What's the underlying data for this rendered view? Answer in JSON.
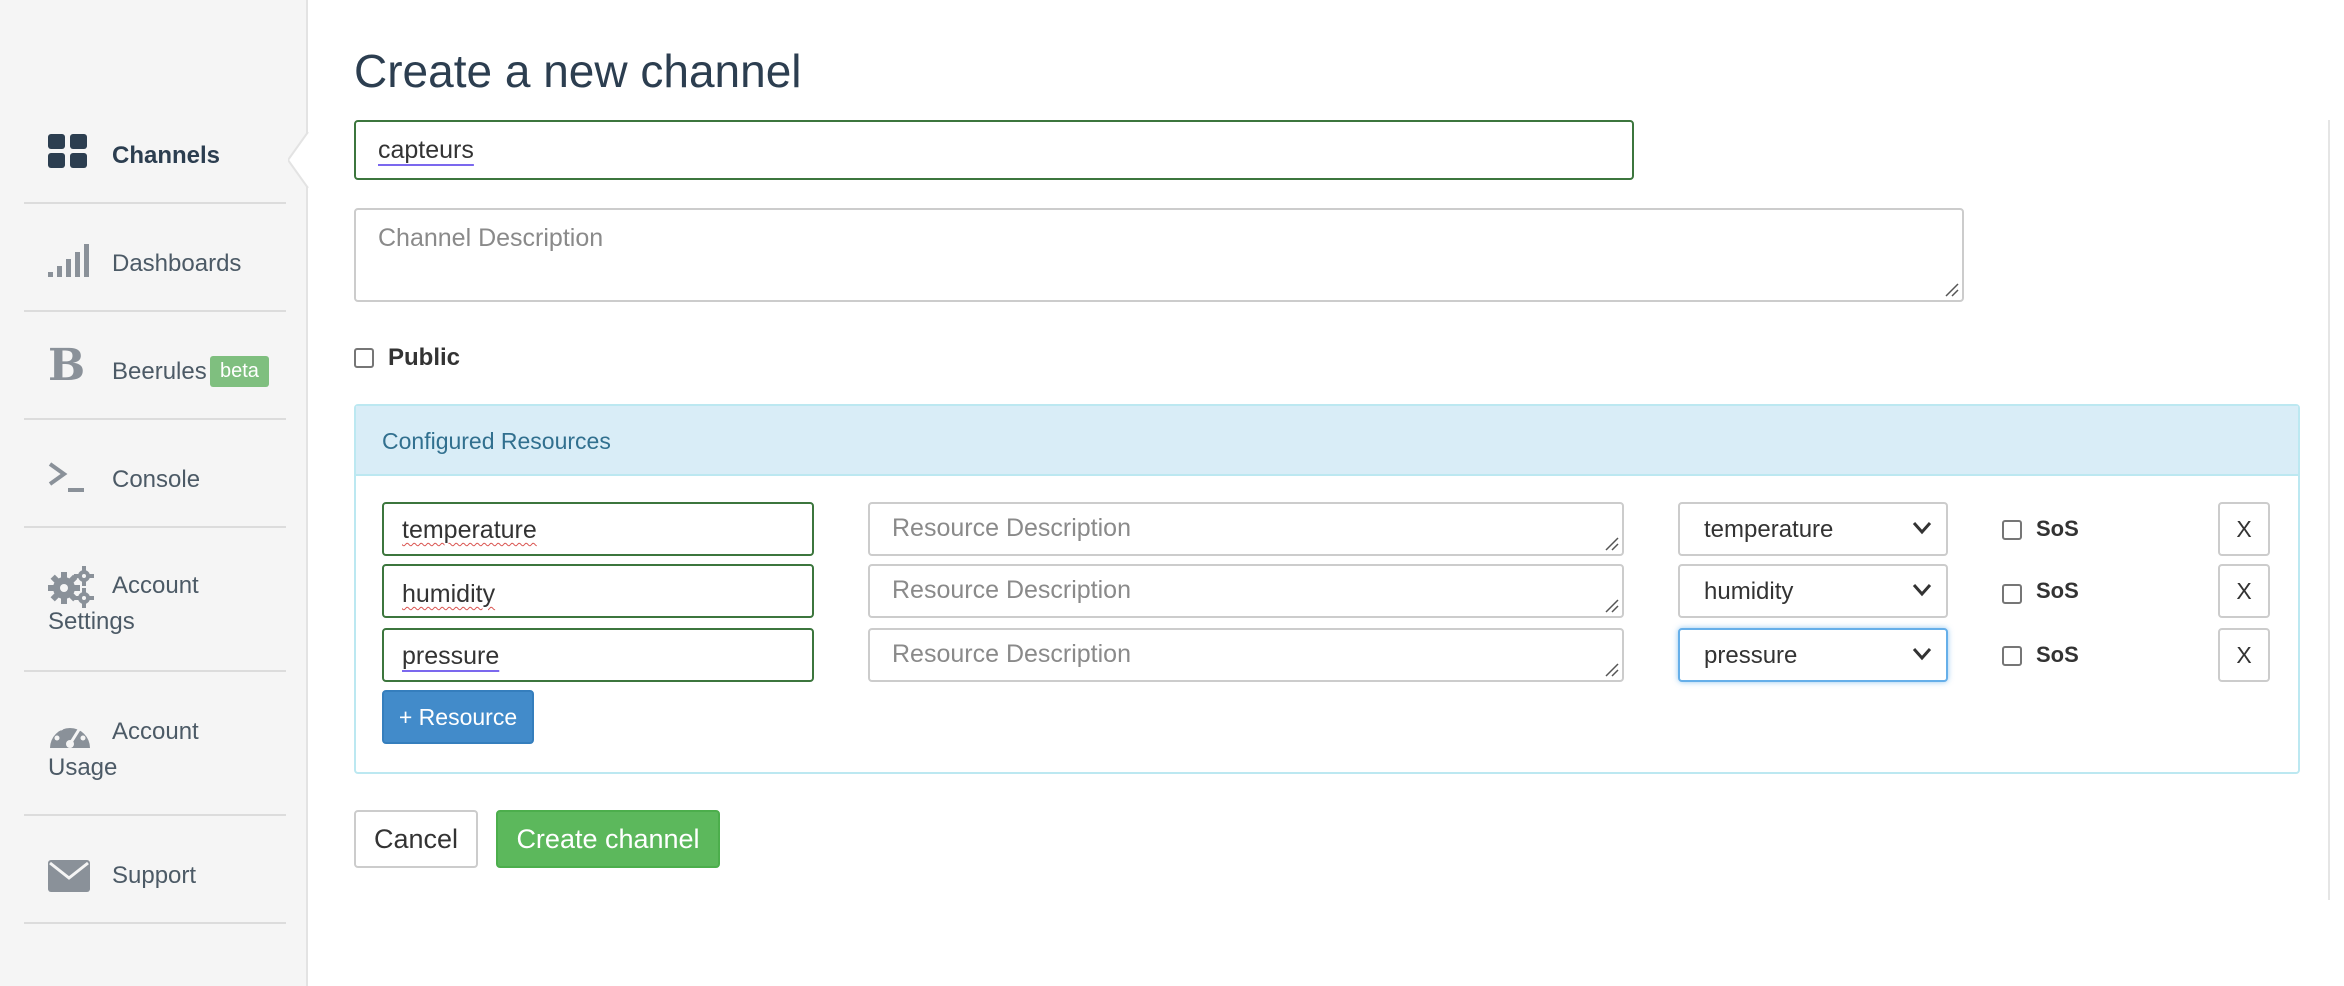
{
  "sidebar": {
    "items": [
      {
        "label": "Channels",
        "icon": "grid-icon"
      },
      {
        "label": "Dashboards",
        "icon": "signal-bars-icon"
      },
      {
        "label": "Beerules",
        "icon": "b-letter-icon",
        "badge": "beta"
      },
      {
        "label": "Console",
        "icon": "terminal-icon"
      },
      {
        "label_line1": "Account",
        "label_line2": "Settings",
        "icon": "gears-icon"
      },
      {
        "label_line1": "Account",
        "label_line2": "Usage",
        "icon": "dashboard-gauge-icon"
      },
      {
        "label": "Support",
        "icon": "envelope-icon"
      }
    ]
  },
  "form": {
    "title": "Create a new channel",
    "channel_name": "capteurs",
    "channel_description_placeholder": "Channel Description",
    "public_label": "Public"
  },
  "resources": {
    "heading": "Configured Resources",
    "rows": [
      {
        "name": "temperature",
        "description_placeholder": "Resource Description",
        "type": "temperature",
        "sos_label": "SoS",
        "remove_label": "X"
      },
      {
        "name": "humidity",
        "description_placeholder": "Resource Description",
        "type": "humidity",
        "sos_label": "SoS",
        "remove_label": "X"
      },
      {
        "name": "pressure",
        "description_placeholder": "Resource Description",
        "type": "pressure",
        "sos_label": "SoS",
        "remove_label": "X"
      }
    ],
    "add_label": "+ Resource"
  },
  "actions": {
    "cancel_label": "Cancel",
    "create_label": "Create channel"
  },
  "colors": {
    "primary": "#428bca",
    "success": "#5cb85c",
    "valid_border": "#3c763d",
    "panel_heading_bg": "#d9edf7",
    "panel_heading_text": "#31708f",
    "beta_badge": "#7fbf7f"
  }
}
